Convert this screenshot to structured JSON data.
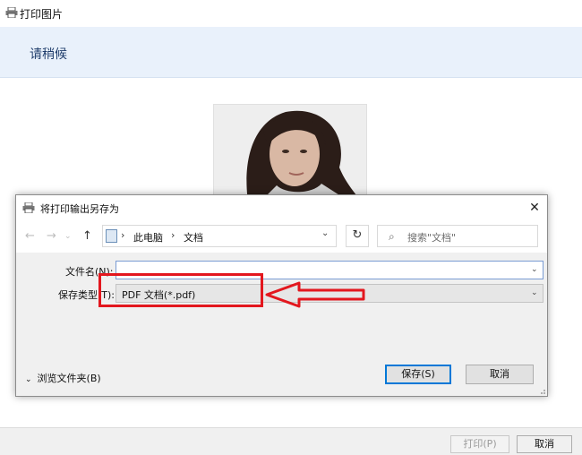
{
  "window": {
    "title": "打印图片",
    "banner_text": "请稍候"
  },
  "footer": {
    "print_label": "打印(P)",
    "cancel_label": "取消"
  },
  "dialog": {
    "title": "将打印输出另存为",
    "breadcrumb": [
      "此电脑",
      "文档"
    ],
    "search_placeholder": "搜索\"文档\"",
    "filename_label": "文件名(N):",
    "filename_value": "",
    "filetype_label": "保存类型(T):",
    "filetype_value": "PDF 文档(*.pdf)",
    "browse_folders_label": "浏览文件夹(B)",
    "save_label": "保存(S)",
    "cancel_label": "取消"
  },
  "colors": {
    "annotation": "#e3171e",
    "accent": "#0078d7",
    "banner_bg": "#e9f1fb"
  }
}
